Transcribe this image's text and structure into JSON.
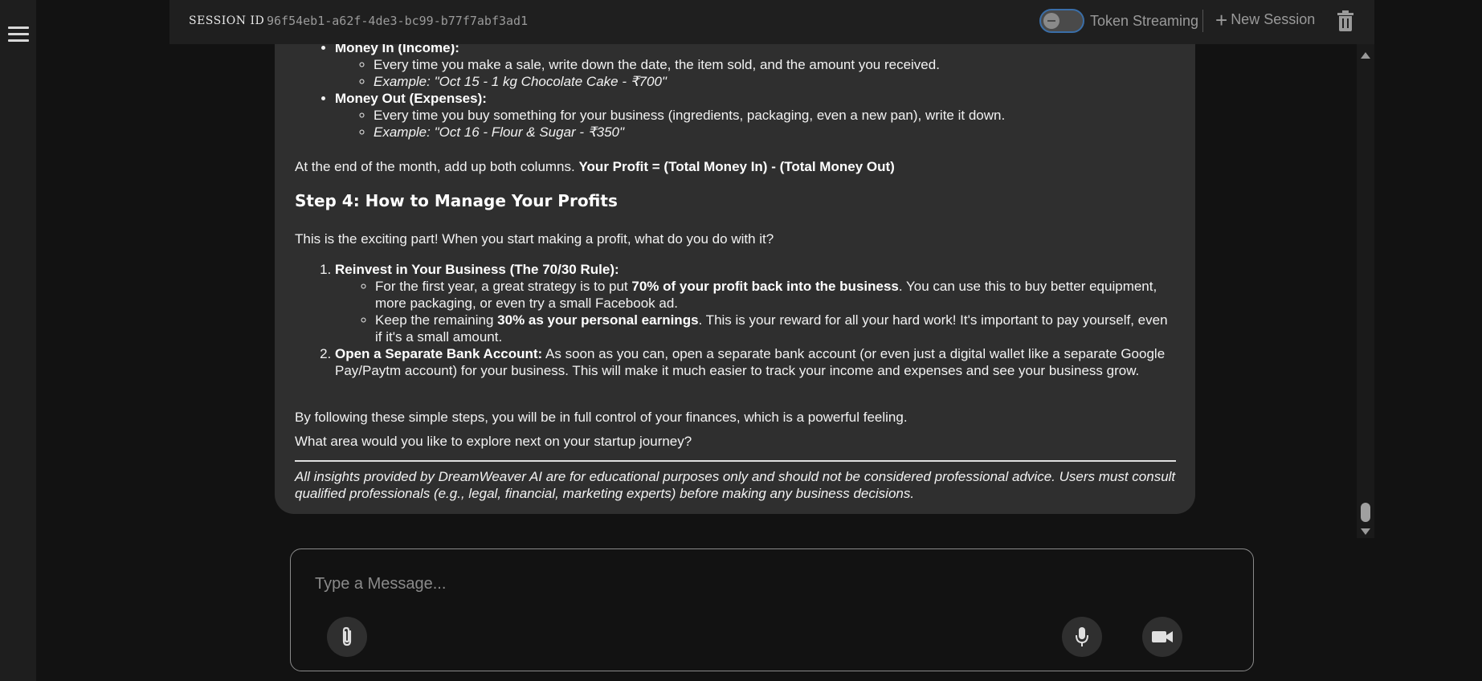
{
  "header": {
    "session_label": "SESSION ID",
    "session_id": "96f54eb1-a62f-4de3-bc99-b77f7abf3ad1",
    "token_streaming_label": "Token Streaming",
    "new_session_label": "New Session"
  },
  "message": {
    "money_in_title": "Money In (Income):",
    "money_in_1": "Every time you make a sale, write down the date, the item sold, and the amount you received.",
    "money_in_2": "Example: \"Oct 15 - 1 kg Chocolate Cake - ₹700\"",
    "money_out_title": "Money Out (Expenses):",
    "money_out_1": "Every time you buy something for your business (ingredients, packaging, even a new pan), write it down.",
    "money_out_2": "Example: \"Oct 16 - Flour & Sugar - ₹350\"",
    "month_end_text": "At the end of the month, add up both columns. ",
    "month_end_bold": "Your Profit = (Total Money In) - (Total Money Out)",
    "step4_heading": "Step 4: How to Manage Your Profits",
    "step4_intro": "This is the exciting part! When you start making a profit, what do you do with it?",
    "reinvest_title": "Reinvest in Your Business (The 70/30 Rule):",
    "reinvest_1_pre": "For the first year, a great strategy is to put ",
    "reinvest_1_bold": "70% of your profit back into the business",
    "reinvest_1_post": ". You can use this to buy better equipment, more packaging, or even try a small Facebook ad.",
    "reinvest_2_pre": "Keep the remaining ",
    "reinvest_2_bold": "30% as your personal earnings",
    "reinvest_2_post": ". This is your reward for all your hard work! It's important to pay yourself, even if it's a small amount.",
    "bank_title": "Open a Separate Bank Account:",
    "bank_text": " As soon as you can, open a separate bank account (or even just a digital wallet like a separate Google Pay/Paytm account) for your business. This will make it much easier to track your income and expenses and see your business grow.",
    "closing": "By following these simple steps, you will be in full control of your finances, which is a powerful feeling.",
    "question": "What area would you like to explore next on your startup journey?",
    "disclaimer": "All insights provided by DreamWeaver AI are for educational purposes only and should not be considered professional advice. Users must consult qualified professionals (e.g., legal, financial, marketing experts) before making any business decisions."
  },
  "composer": {
    "placeholder": "Type a Message..."
  },
  "icons": {
    "menu": "hamburger-icon",
    "toggle": "toggle-switch",
    "new": "plus-icon",
    "delete": "trash-icon",
    "attach": "paperclip-icon",
    "mic": "microphone-icon",
    "video": "video-camera-icon"
  },
  "colors": {
    "background": "#121212",
    "header": "#1f1f1f",
    "bubble": "#2f2f2f",
    "toggle_border": "#3a6ea8",
    "muted_text": "#9a9a9a"
  }
}
